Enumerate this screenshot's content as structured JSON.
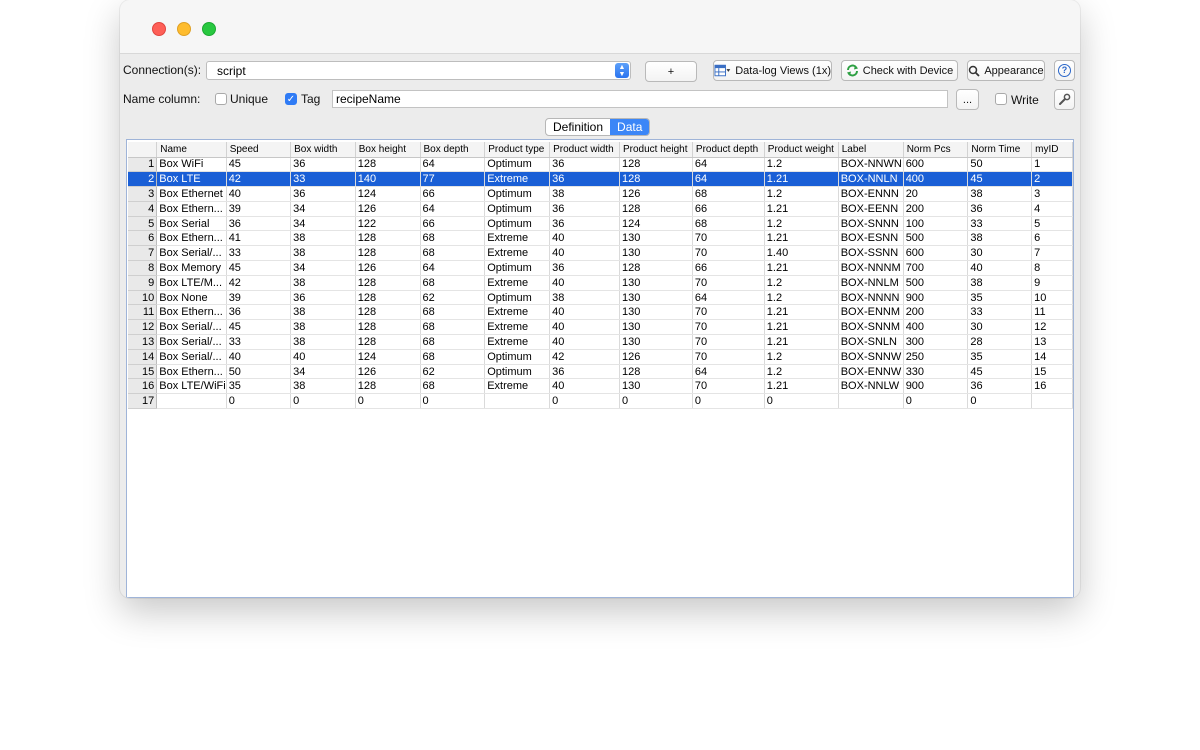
{
  "connection": {
    "label": "Connection(s):",
    "value": "script"
  },
  "toolbar": {
    "add_label": "+",
    "datalog_label": "Data-log Views (1x)",
    "check_label": "Check with Device",
    "appearance_label": "Appearance",
    "help_label": "?"
  },
  "name_column": {
    "label": "Name column:",
    "unique_label": "Unique",
    "unique_checked": false,
    "tag_label": "Tag",
    "tag_checked": true,
    "tag_value": "recipeName",
    "browse_label": "...",
    "write_label": "Write",
    "write_checked": false
  },
  "tabs": [
    {
      "label": "Definition",
      "active": false
    },
    {
      "label": "Data",
      "active": true
    }
  ],
  "table": {
    "columns": [
      "Name",
      "Speed",
      "Box width",
      "Box height",
      "Box depth",
      "Product type",
      "Product width",
      "Product height",
      "Product depth",
      "Product weight",
      "Label",
      "Norm Pcs",
      "Norm Time",
      "myID"
    ],
    "selected_row": 2,
    "rows": [
      {
        "num": "1",
        "cells": [
          "Box WiFi",
          "45",
          "36",
          "128",
          "64",
          "Optimum",
          "36",
          "128",
          "64",
          "1.2",
          "BOX-NNWN",
          "600",
          "50",
          "1"
        ]
      },
      {
        "num": "2",
        "cells": [
          "Box LTE",
          "42",
          "33",
          "140",
          "77",
          "Extreme",
          "36",
          "128",
          "64",
          "1.21",
          "BOX-NNLN",
          "400",
          "45",
          "2"
        ]
      },
      {
        "num": "3",
        "cells": [
          "Box Ethernet",
          "40",
          "36",
          "124",
          "66",
          "Optimum",
          "38",
          "126",
          "68",
          "1.2",
          "BOX-ENNN",
          "20",
          "38",
          "3"
        ]
      },
      {
        "num": "4",
        "cells": [
          "Box Ethern...",
          "39",
          "34",
          "126",
          "64",
          "Optimum",
          "36",
          "128",
          "66",
          "1.21",
          "BOX-EENN",
          "200",
          "36",
          "4"
        ]
      },
      {
        "num": "5",
        "cells": [
          "Box Serial",
          "36",
          "34",
          "122",
          "66",
          "Optimum",
          "36",
          "124",
          "68",
          "1.2",
          "BOX-SNNN",
          "100",
          "33",
          "5"
        ]
      },
      {
        "num": "6",
        "cells": [
          "Box Ethern...",
          "41",
          "38",
          "128",
          "68",
          "Extreme",
          "40",
          "130",
          "70",
          "1.21",
          "BOX-ESNN",
          "500",
          "38",
          "6"
        ]
      },
      {
        "num": "7",
        "cells": [
          "Box Serial/...",
          "33",
          "38",
          "128",
          "68",
          "Extreme",
          "40",
          "130",
          "70",
          "1.40",
          "BOX-SSNN",
          "600",
          "30",
          "7"
        ]
      },
      {
        "num": "8",
        "cells": [
          "Box Memory",
          "45",
          "34",
          "126",
          "64",
          "Optimum",
          "36",
          "128",
          "66",
          "1.21",
          "BOX-NNNM",
          "700",
          "40",
          "8"
        ]
      },
      {
        "num": "9",
        "cells": [
          "Box LTE/M...",
          "42",
          "38",
          "128",
          "68",
          "Extreme",
          "40",
          "130",
          "70",
          "1.2",
          "BOX-NNLM",
          "500",
          "38",
          "9"
        ]
      },
      {
        "num": "10",
        "cells": [
          "Box None",
          "39",
          "36",
          "128",
          "62",
          "Optimum",
          "38",
          "130",
          "64",
          "1.2",
          "BOX-NNNN",
          "900",
          "35",
          "10"
        ]
      },
      {
        "num": "11",
        "cells": [
          "Box Ethern...",
          "36",
          "38",
          "128",
          "68",
          "Extreme",
          "40",
          "130",
          "70",
          "1.21",
          "BOX-ENNM",
          "200",
          "33",
          "11"
        ]
      },
      {
        "num": "12",
        "cells": [
          "Box Serial/...",
          "45",
          "38",
          "128",
          "68",
          "Extreme",
          "40",
          "130",
          "70",
          "1.21",
          "BOX-SNNM",
          "400",
          "30",
          "12"
        ]
      },
      {
        "num": "13",
        "cells": [
          "Box Serial/...",
          "33",
          "38",
          "128",
          "68",
          "Extreme",
          "40",
          "130",
          "70",
          "1.21",
          "BOX-SNLN",
          "300",
          "28",
          "13"
        ]
      },
      {
        "num": "14",
        "cells": [
          "Box Serial/...",
          "40",
          "40",
          "124",
          "68",
          "Optimum",
          "42",
          "126",
          "70",
          "1.2",
          "BOX-SNNW",
          "250",
          "35",
          "14"
        ]
      },
      {
        "num": "15",
        "cells": [
          "Box Ethern...",
          "50",
          "34",
          "126",
          "62",
          "Optimum",
          "36",
          "128",
          "64",
          "1.2",
          "BOX-ENNW",
          "330",
          "45",
          "15"
        ]
      },
      {
        "num": "16",
        "cells": [
          "Box LTE/WiFi",
          "35",
          "38",
          "128",
          "68",
          "Extreme",
          "40",
          "130",
          "70",
          "1.21",
          "BOX-NNLW",
          "900",
          "36",
          "16"
        ]
      },
      {
        "num": "17",
        "cells": [
          "",
          "0",
          "0",
          "0",
          "0",
          "",
          "0",
          "0",
          "0",
          "0",
          "",
          "0",
          "0",
          ""
        ]
      }
    ]
  }
}
